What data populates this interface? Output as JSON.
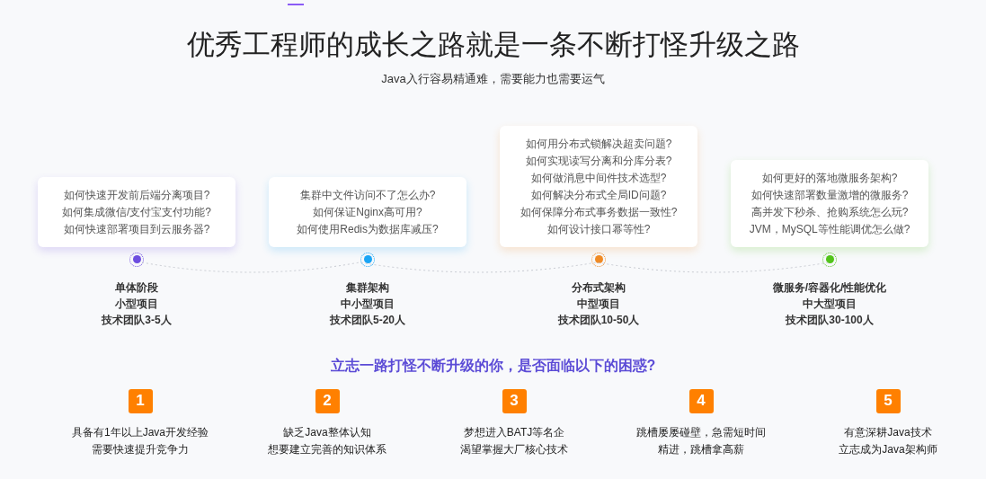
{
  "title": "优秀工程师的成长之路就是一条不断打怪升级之路",
  "subtitle": "Java入行容易精通难，需要能力也需要运气",
  "stages": [
    {
      "color": "#6d4de0",
      "questions": [
        "如何快速开发前后端分离项目?",
        "如何集成微信/支付宝支付功能?",
        "如何快速部署项目到云服务器?"
      ],
      "labels": [
        "单体阶段",
        "小型项目",
        "技术团队3-5人"
      ]
    },
    {
      "color": "#1aa5f5",
      "questions": [
        "集群中文件访问不了怎么办?",
        "如何保证Nginx高可用?",
        "如何使用Redis为数据库减压?"
      ],
      "labels": [
        "集群架构",
        "中小型项目",
        "技术团队5-20人"
      ]
    },
    {
      "color": "#f08a24",
      "questions": [
        "如何用分布式锁解决超卖问题?",
        "如何实现读写分离和分库分表?",
        "如何做消息中间件技术选型?",
        "如何解决分布式全局ID问题?",
        "如何保障分布式事务数据一致性?",
        "如何设计接口幂等性?"
      ],
      "labels": [
        "分布式架构",
        "中型项目",
        "技术团队10-50人"
      ]
    },
    {
      "color": "#52c41a",
      "questions": [
        "如何更好的落地微服务架构?",
        "如何快速部署数量激增的微服务?",
        "高并发下秒杀、抢购系统怎么玩?",
        "JVM，MySQL等性能调优怎么做?"
      ],
      "labels": [
        "微服务/容器化/性能优化",
        "中大型项目",
        "技术团队30-100人"
      ]
    }
  ],
  "question_heading": "立志一路打怪不断升级的你，是否面临以下的困惑?",
  "troubles": [
    {
      "number": "1",
      "lines": [
        "具备有1年以上Java开发经验",
        "需要快速提升竞争力"
      ]
    },
    {
      "number": "2",
      "lines": [
        "缺乏Java整体认知",
        "想要建立完善的知识体系"
      ]
    },
    {
      "number": "3",
      "lines": [
        "梦想进入BATJ等名企",
        "渴望掌握大厂核心技术"
      ]
    },
    {
      "number": "4",
      "lines": [
        "跳槽屡屡碰壁，急需短时间",
        "精进，跳槽拿高薪"
      ]
    },
    {
      "number": "5",
      "lines": [
        "有意深耕Java技术",
        "立志成为Java架构师"
      ]
    }
  ]
}
